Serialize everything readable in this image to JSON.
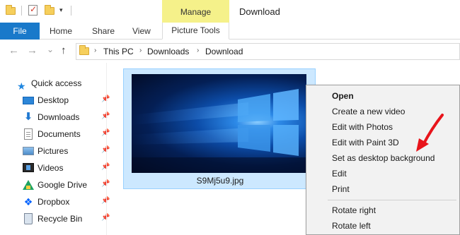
{
  "window": {
    "title": "Download",
    "contextual_group": "Manage",
    "qa_dropdown": "▾"
  },
  "ribbon": {
    "file_tab": "File",
    "tabs": [
      "Home",
      "Share",
      "View"
    ],
    "contextual_tab": "Picture Tools"
  },
  "navigation": {
    "back": "←",
    "forward": "→",
    "recent": "⌄",
    "up": "↑",
    "breadcrumb": [
      "This PC",
      "Downloads",
      "Download"
    ],
    "separator": "›"
  },
  "sidebar": {
    "quick_access_label": "Quick access",
    "pin_glyph": "📌",
    "items": [
      {
        "label": "Desktop",
        "icon": "desktop-icon",
        "pinned": true
      },
      {
        "label": "Downloads",
        "icon": "downloads-icon",
        "pinned": true
      },
      {
        "label": "Documents",
        "icon": "documents-icon",
        "pinned": true
      },
      {
        "label": "Pictures",
        "icon": "pictures-icon",
        "pinned": true
      },
      {
        "label": "Videos",
        "icon": "videos-icon",
        "pinned": true
      },
      {
        "label": "Google Drive",
        "icon": "google-drive-icon",
        "pinned": true
      },
      {
        "label": "Dropbox",
        "icon": "dropbox-icon",
        "pinned": true
      },
      {
        "label": "Recycle Bin",
        "icon": "recycle-bin-icon",
        "pinned": true
      }
    ]
  },
  "file": {
    "name": "S9Mj5u9.jpg",
    "selected": true
  },
  "context_menu": {
    "items": [
      {
        "label": "Open",
        "bold": true
      },
      {
        "label": "Create a new video"
      },
      {
        "label": "Edit with Photos"
      },
      {
        "label": "Edit with Paint 3D"
      },
      {
        "label": "Set as desktop background"
      },
      {
        "label": "Edit"
      },
      {
        "label": "Print"
      },
      {
        "label": "Rotate right"
      },
      {
        "label": "Rotate left"
      }
    ]
  },
  "colors": {
    "accent": "#1979ca",
    "manage_highlight": "#f5f18a",
    "selection": "#cce8ff",
    "annotation_arrow": "#e8141b"
  }
}
